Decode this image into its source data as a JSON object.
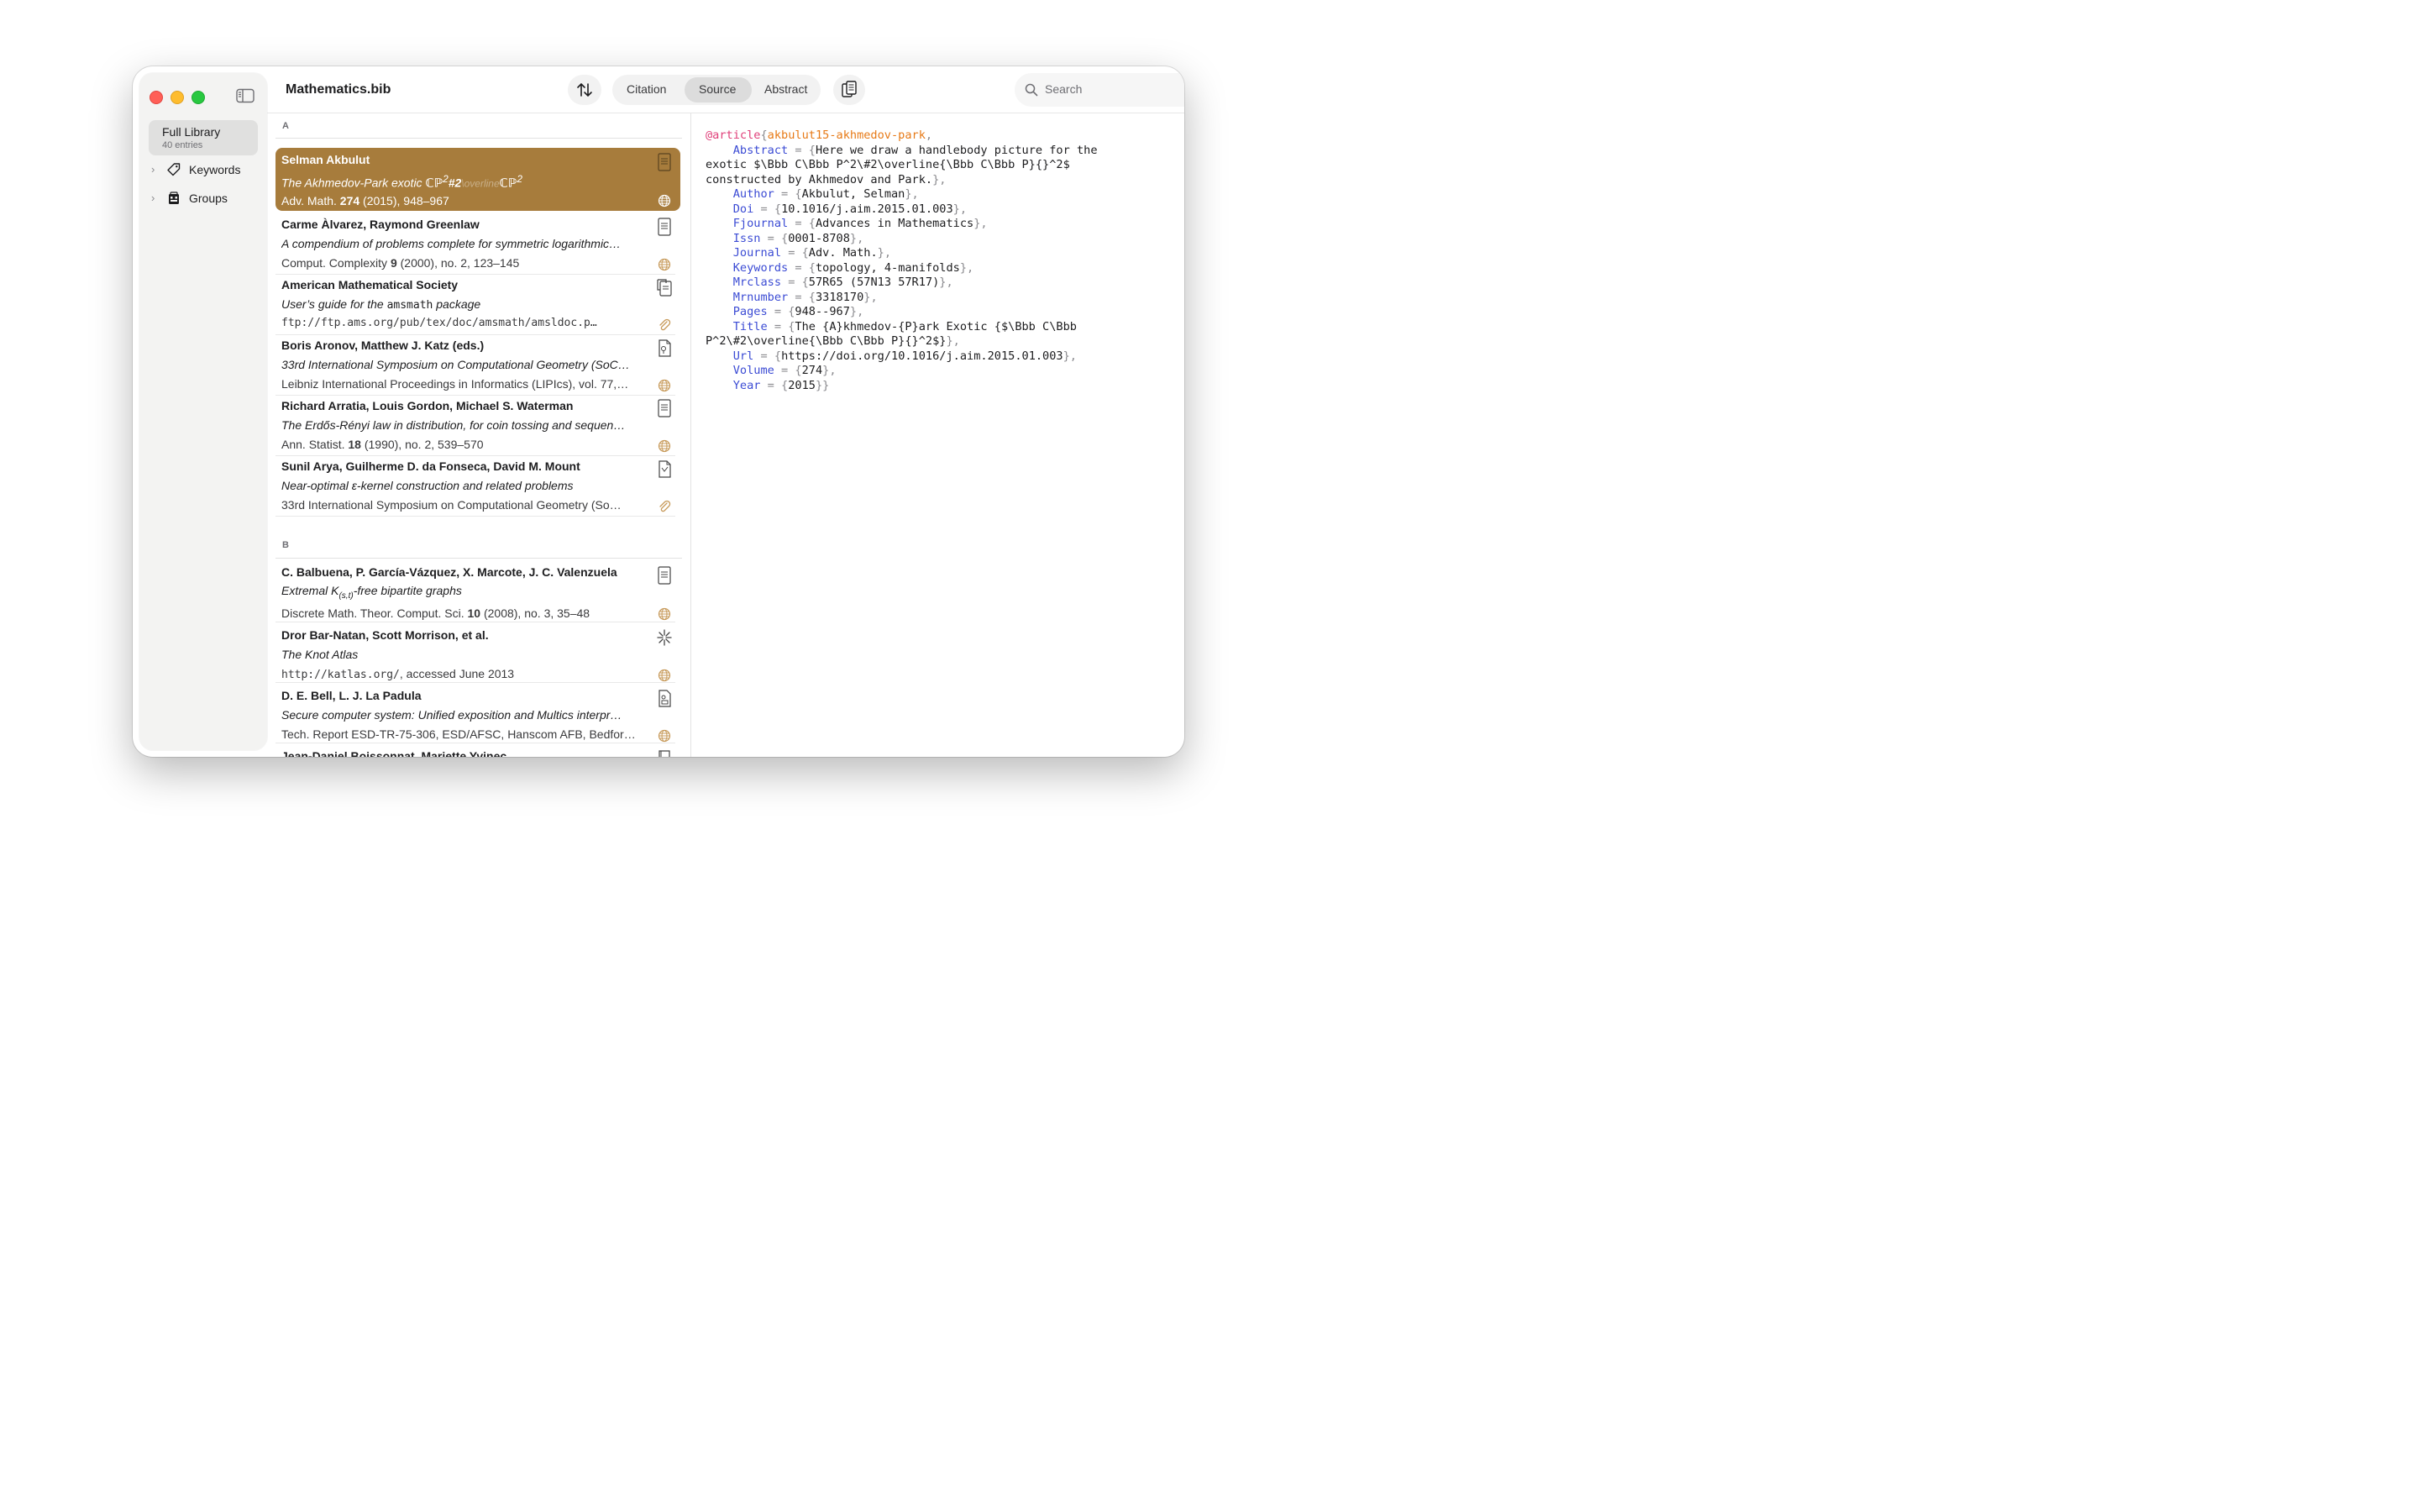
{
  "window": {
    "file_title": "Mathematics.bib"
  },
  "sidebar": {
    "library": {
      "title": "Full Library",
      "subtitle": "40 entries"
    },
    "items": [
      {
        "label": "Keywords",
        "icon": "tag-icon"
      },
      {
        "label": "Groups",
        "icon": "groups-icon"
      }
    ]
  },
  "toolbar": {
    "tabs": [
      "Citation",
      "Source",
      "Abstract"
    ],
    "active_tab": "Source",
    "search_placeholder": "Search"
  },
  "list": {
    "sections": [
      "A",
      "B"
    ],
    "entries": [
      {
        "authors": "Selman Akbulut",
        "title_a": "The Akhmedov-Park exotic ",
        "title_b": "ℂℙ",
        "title_c": "2",
        "title_d": "#2",
        "title_e": "\\overline",
        "title_f": "ℂℙ",
        "title_g": "2",
        "pub_a": "Adv. Math. ",
        "pub_b": "274",
        "pub_c": " (2015), 948–967",
        "type_icon": "document-icon",
        "link_icon": "globe-icon",
        "selected": true
      },
      {
        "authors": "Carme Àlvarez, Raymond Greenlaw",
        "title": "A compendium of problems complete for symmetric logarithmic…",
        "pub_a": "Comput. Complexity ",
        "pub_b": "9",
        "pub_c": " (2000), no. 2, 123–145",
        "type_icon": "document-icon",
        "link_icon": "globe-icon"
      },
      {
        "authors": "American Mathematical Society",
        "title_a": "User’s guide for the ",
        "title_b": "amsmath",
        "title_c": " package",
        "pub": "ftp://ftp.ams.org/pub/tex/doc/amsmath/amsldoc.p…",
        "type_icon": "manual-icon",
        "link_icon": "paperclip-icon"
      },
      {
        "authors": "Boris Aronov, Matthew J. Katz (eds.)",
        "title": "33rd International Symposium on Computational Geometry (SoC…",
        "pub": "Leibniz International Proceedings in Informatics (LIPIcs), vol. 77,…",
        "type_icon": "proceedings-icon",
        "link_icon": "globe-icon"
      },
      {
        "authors": "Richard Arratia, Louis Gordon, Michael S. Waterman",
        "title": "The Erdős-Rényi law in distribution, for coin tossing and sequen…",
        "pub_a": "Ann. Statist. ",
        "pub_b": "18",
        "pub_c": " (1990), no. 2, 539–570",
        "type_icon": "document-icon",
        "link_icon": "globe-icon"
      },
      {
        "authors": "Sunil Arya, Guilherme D. da Fonseca, David M. Mount",
        "title": "Near-optimal ε-kernel construction and related problems",
        "pub": "33rd International Symposium on Computational Geometry (So…",
        "type_icon": "inproceedings-icon",
        "link_icon": "paperclip-icon"
      },
      {
        "authors": "C. Balbuena, P. García-Vázquez, X. Marcote, J. C. Valenzuela",
        "title_a": "Extremal ",
        "title_b": "K",
        "title_c": "(s,t)",
        "title_d": "-free bipartite graphs",
        "pub_a": "Discrete Math. Theor. Comput. Sci. ",
        "pub_b": "10",
        "pub_c": " (2008), no. 3, 35–48",
        "type_icon": "document-icon",
        "link_icon": "globe-icon"
      },
      {
        "authors": "Dror Bar-Natan, Scott Morrison, et al.",
        "title": "The Knot Atlas",
        "pub_a": "http://katlas.org/",
        "pub_b": ", accessed June 2013",
        "type_icon": "misc-icon",
        "link_icon": "globe-icon"
      },
      {
        "authors": "D. E. Bell, L. J. La Padula",
        "title": "Secure computer system: Unified exposition and Multics interpr…",
        "pub": "Tech. Report ESD-TR-75-306, ESD/AFSC, Hanscom AFB, Bedfor…",
        "type_icon": "techreport-icon",
        "link_icon": "globe-icon"
      },
      {
        "authors": "Jean-Daniel Boissonnat, Mariette Yvinec",
        "type_icon": "book-icon"
      }
    ]
  },
  "source": {
    "entry_type": "@article",
    "cite_key": "akbulut15-akhmedov-park",
    "fields": [
      {
        "name": "Abstract",
        "value": "Here we draw a handlebody picture for the",
        "cont": [
          "exotic $\\Bbb C\\Bbb P^2\\#2\\overline{\\Bbb C\\Bbb P}{}^2$",
          "constructed by Akhmedov and Park."
        ]
      },
      {
        "name": "Author",
        "value": "Akbulut, Selman"
      },
      {
        "name": "Doi",
        "value": "10.1016/j.aim.2015.01.003"
      },
      {
        "name": "Fjournal",
        "value": "Advances in Mathematics"
      },
      {
        "name": "Issn",
        "value": "0001-8708"
      },
      {
        "name": "Journal",
        "value": "Adv. Math."
      },
      {
        "name": "Keywords",
        "value": "topology, 4-manifolds"
      },
      {
        "name": "Mrclass",
        "value": "57R65 (57N13 57R17)"
      },
      {
        "name": "Mrnumber",
        "value": "3318170"
      },
      {
        "name": "Pages",
        "value": "948--967"
      },
      {
        "name": "Title",
        "value": "The {A}khmedov-{P}ark Exotic {$\\Bbb C\\Bbb",
        "cont": [
          "P^2\\#2\\overline{\\Bbb C\\Bbb P}{}^2$}"
        ]
      },
      {
        "name": "Url",
        "value": "https://doi.org/10.1016/j.aim.2015.01.003"
      },
      {
        "name": "Volume",
        "value": "274"
      },
      {
        "name": "Year",
        "value": "2015"
      }
    ]
  },
  "colors": {
    "selection": "#a77c3c",
    "entry_type": "#e0407a",
    "cite_key": "#e77a17",
    "field_name": "#3b4bd4",
    "link_icon": "#c79a5a"
  }
}
